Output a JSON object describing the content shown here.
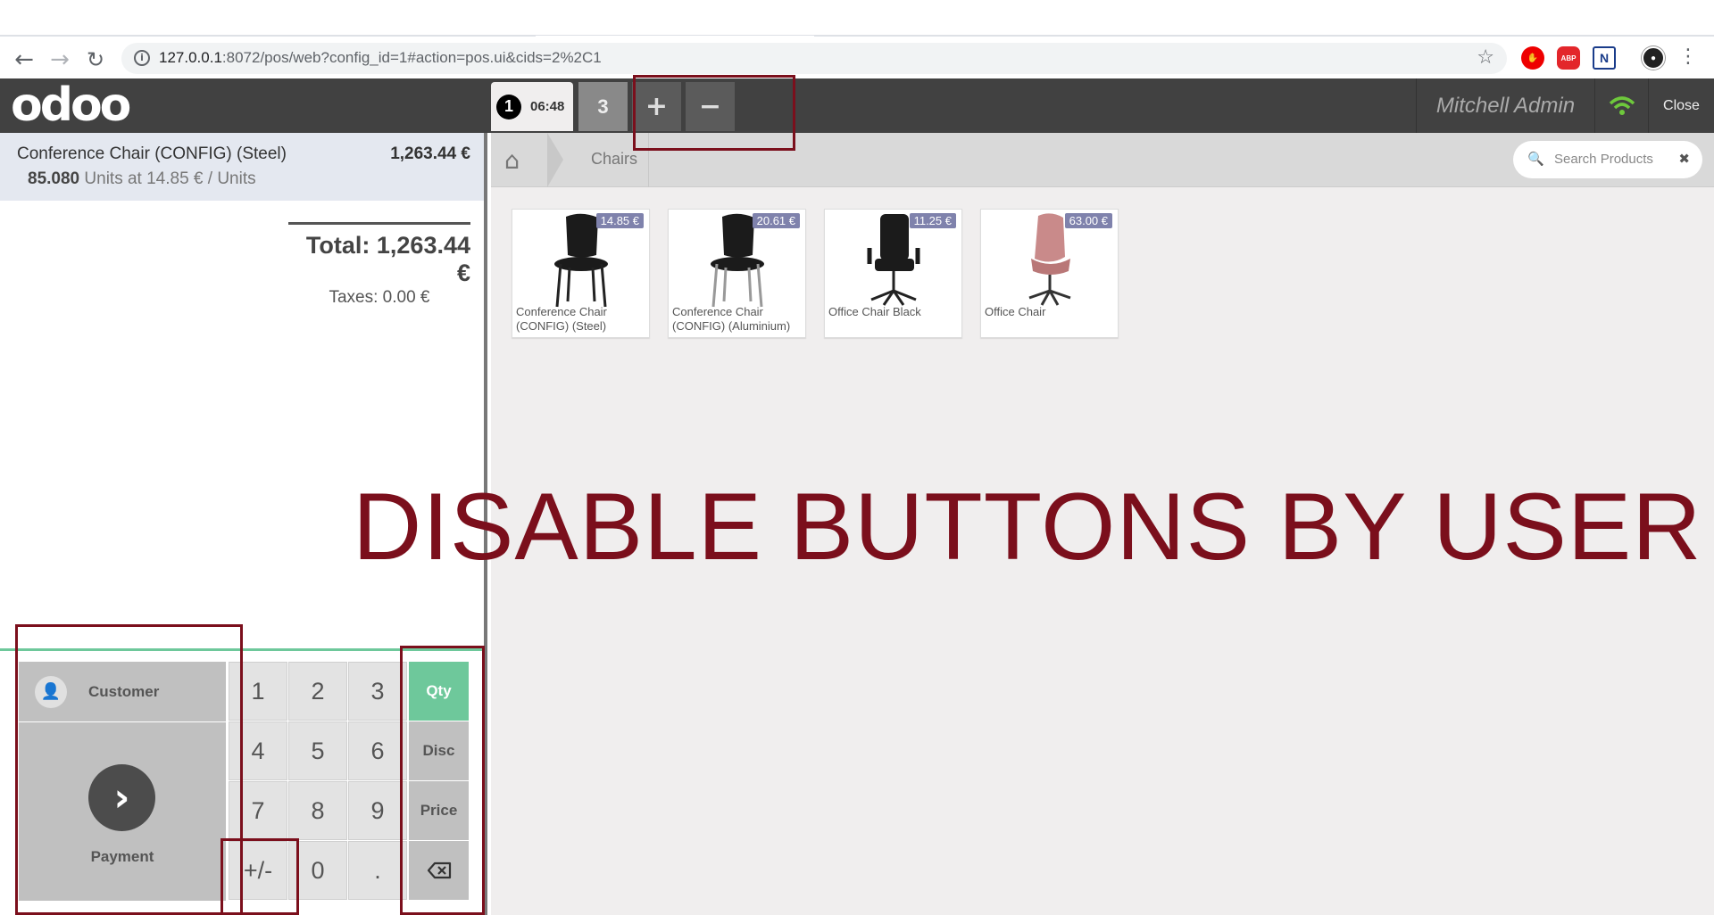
{
  "browser": {
    "url_host": "127.0.0.1",
    "url_rest": ":8072/pos/web?config_id=1#action=pos.ui&cids=2%2C1"
  },
  "header": {
    "logo_text": "odoo",
    "active_order_number": "1",
    "active_order_time": "06:48",
    "other_order_number": "3",
    "username": "Mitchell Admin",
    "close_label": "Close"
  },
  "order": {
    "line": {
      "name": "Conference Chair (CONFIG) (Steel)",
      "price": "1,263.44 €",
      "qty": "85.080",
      "unit_info": " Units at 14.85 € / Units"
    },
    "total": "Total: 1,263.44 €",
    "taxes": "Taxes: 0.00 €"
  },
  "pad": {
    "customer_label": "Customer",
    "payment_label": "Payment",
    "keys": [
      "1",
      "2",
      "3",
      "4",
      "5",
      "6",
      "7",
      "8",
      "9",
      "+/-",
      "0",
      "."
    ],
    "modes": [
      "Qty",
      "Disc",
      "Price"
    ]
  },
  "products_pane": {
    "category": "Chairs",
    "search_placeholder": "Search Products",
    "products": [
      {
        "name": "Conference Chair (CONFIG) (Steel)",
        "price": "14.85 €"
      },
      {
        "name": "Conference Chair (CONFIG) (Aluminium)",
        "price": "20.61 €"
      },
      {
        "name": "Office Chair Black",
        "price": "11.25 €"
      },
      {
        "name": "Office Chair",
        "price": "63.00 €"
      }
    ]
  },
  "annotation": {
    "title": "DISABLE BUTTONS BY USER",
    "color": "#7b0f1c"
  },
  "colors": {
    "header_bg": "#414141",
    "accent_green": "#6ec89b",
    "price_tag": "#7f82ac"
  }
}
